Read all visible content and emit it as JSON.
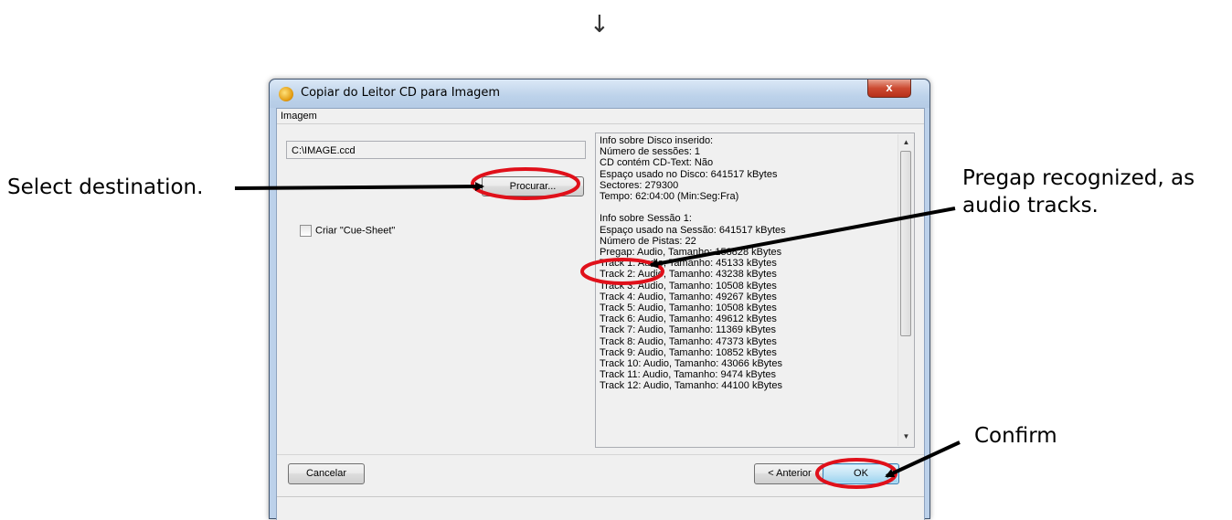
{
  "top_arrow": "↓",
  "annotations": {
    "select_destination": "Select destination.",
    "pregap_recognized": "Pregap recognized, as audio tracks.",
    "confirm": "Confirm"
  },
  "window": {
    "title": "Copiar do Leitor CD para Imagem",
    "close_symbol": "x",
    "group_label": "Imagem",
    "path_value": "C:\\IMAGE.ccd",
    "browse_label": "Procurar...",
    "cue_sheet_label": "Criar \"Cue-Sheet\"",
    "info_lines": [
      "Info sobre Disco inserido:",
      "Número de sessões: 1",
      "CD contém CD-Text: Não",
      "Espaço usado no Disco: 641517 kBytes",
      "Sectores: 279300",
      "Tempo: 62:04:00 (Min:Seg:Fra)",
      "",
      "Info sobre Sessão 1:",
      "Espaço usado na Sessão: 641517 kBytes",
      "Número de Pistas: 22",
      "Pregap: Audio, Tamanho: 158828 kBytes",
      "Track 1: Audio, Tamanho: 45133 kBytes",
      "Track 2: Audio, Tamanho: 43238 kBytes",
      "Track 3: Audio, Tamanho: 10508 kBytes",
      "Track 4: Audio, Tamanho: 49267 kBytes",
      "Track 5: Audio, Tamanho: 10508 kBytes",
      "Track 6: Audio, Tamanho: 49612 kBytes",
      "Track 7: Audio, Tamanho: 11369 kBytes",
      "Track 8: Audio, Tamanho: 47373 kBytes",
      "Track 9: Audio, Tamanho: 10852 kBytes",
      "Track 10: Audio, Tamanho: 43066 kBytes",
      "Track 11: Audio, Tamanho: 9474 kBytes",
      "Track 12: Audio, Tamanho: 44100 kBytes"
    ],
    "cancel_label": "Cancelar",
    "previous_label": "< Anterior",
    "ok_label": "OK"
  },
  "colors": {
    "highlight_ellipse": "#e0101a",
    "arrow": "#000000",
    "ok_button_accent": "#3c7fb1"
  }
}
